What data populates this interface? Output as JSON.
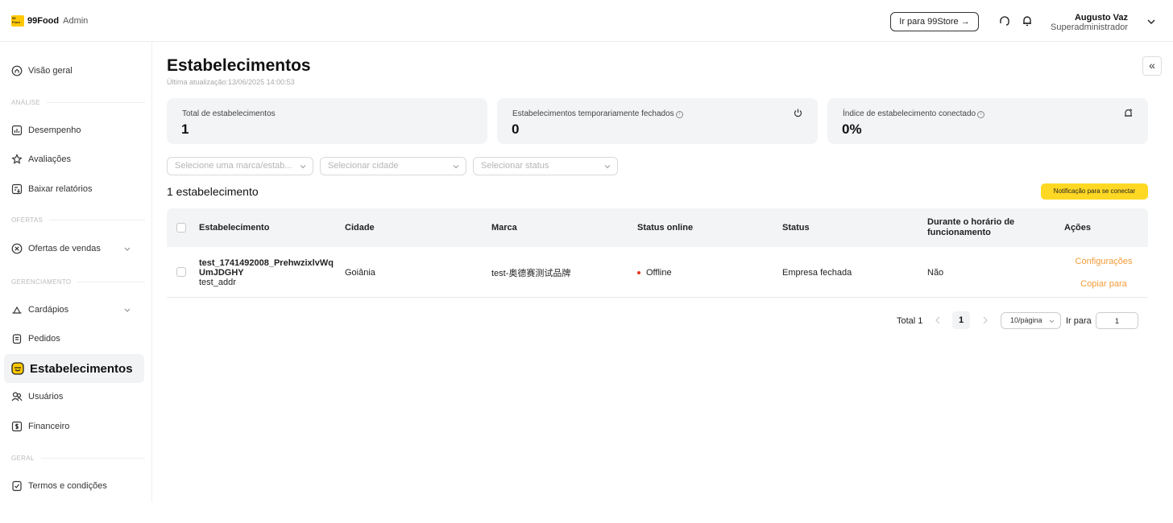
{
  "app": {
    "logo_text": "99 Food",
    "brand": "99Food",
    "suffix": "Admin"
  },
  "topbar": {
    "store_button": "Ir para 99Store →",
    "user_name": "Augusto Vaz",
    "user_role": "Superadministrador",
    "icons": [
      "headset-icon",
      "bell-icon",
      "chevron-down-icon"
    ]
  },
  "sidebar": {
    "overview": "Visão geral",
    "sections": {
      "analysis": "ANÁLISE",
      "offers": "OFERTAS",
      "management": "GERENCIAMENTO",
      "general": "GERAL"
    },
    "items": {
      "performance": "Desempenho",
      "reviews": "Avaliações",
      "reports": "Baixar relatórios",
      "sales_offers": "Ofertas de vendas",
      "menus": "Cardápios",
      "orders": "Pedidos",
      "establishments": "Estabelecimentos",
      "users": "Usuários",
      "financial": "Financeiro",
      "terms": "Termos e condições"
    },
    "active": "establishments"
  },
  "page": {
    "title": "Estabelecimentos",
    "updated": "Última atualização:13/06/2025 14:00:53",
    "collapse_icon": "«"
  },
  "cards": [
    {
      "label": "Total de estabelecimentos",
      "value": "1"
    },
    {
      "label": "Estabelecimentos temporariamente fechados",
      "value": "0",
      "icon": "power-icon"
    },
    {
      "label": "Índice de estabelecimento conectado",
      "value": "0%",
      "icon": "bell-off-icon"
    }
  ],
  "filters": {
    "brand": "Selecione uma marca/estab...",
    "city": "Selecionar cidade",
    "status": "Selecionar status"
  },
  "list": {
    "count_label": "1 estabelecimento",
    "notify_button": "Notificação para se conectar"
  },
  "table": {
    "headers": {
      "establishment": "Estabelecimento",
      "city": "Cidade",
      "brand": "Marca",
      "online_status": "Status online",
      "status": "Status",
      "during_hours": "Durante o horário de funcionamento",
      "actions": "Ações"
    },
    "rows": [
      {
        "name_line1": "test_1741492008_PrehwzixlvWq",
        "name_line2": "UmJDGHY",
        "address": "test_addr",
        "city": "Goiânia",
        "brand": "test-奥德赛测试品牌",
        "online_status": "Offline",
        "status": "Empresa fechada",
        "during_hours": "Não",
        "action_settings": "Configurações",
        "action_copy": "Copiar para"
      }
    ]
  },
  "pagination": {
    "total": "Total 1",
    "current_page": "1",
    "page_size": "10/página",
    "goto_label": "Ir para",
    "goto_value": "1"
  },
  "colors": {
    "accent_yellow": "#ffd824",
    "action_orange": "#f29b38",
    "offline_red": "#e8331f"
  }
}
